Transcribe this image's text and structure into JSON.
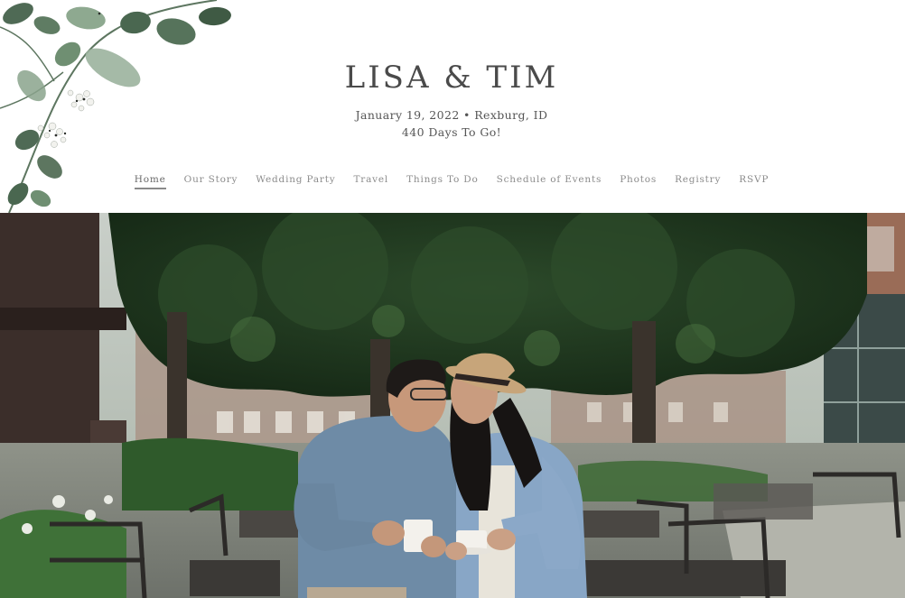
{
  "site": {
    "couple_names": "LISA & TIM",
    "event_details": "January 19, 2022 • Rexburg, ID",
    "countdown": "440 Days To Go!"
  },
  "nav": {
    "items": [
      {
        "label": "Home",
        "active": true
      },
      {
        "label": "Our Story"
      },
      {
        "label": "Wedding Party"
      },
      {
        "label": "Travel"
      },
      {
        "label": "Things To Do"
      },
      {
        "label": "Schedule of Events"
      },
      {
        "label": "Photos"
      },
      {
        "label": "Registry"
      },
      {
        "label": "RSVP"
      }
    ]
  },
  "colors": {
    "title": "#4a4a4a",
    "nav_text": "#8c8c8c",
    "leaf_green": "#6f8f72",
    "foliage": "#1f3a1f"
  },
  "decor": {
    "icon": "eucalyptus-botanical-icon"
  }
}
